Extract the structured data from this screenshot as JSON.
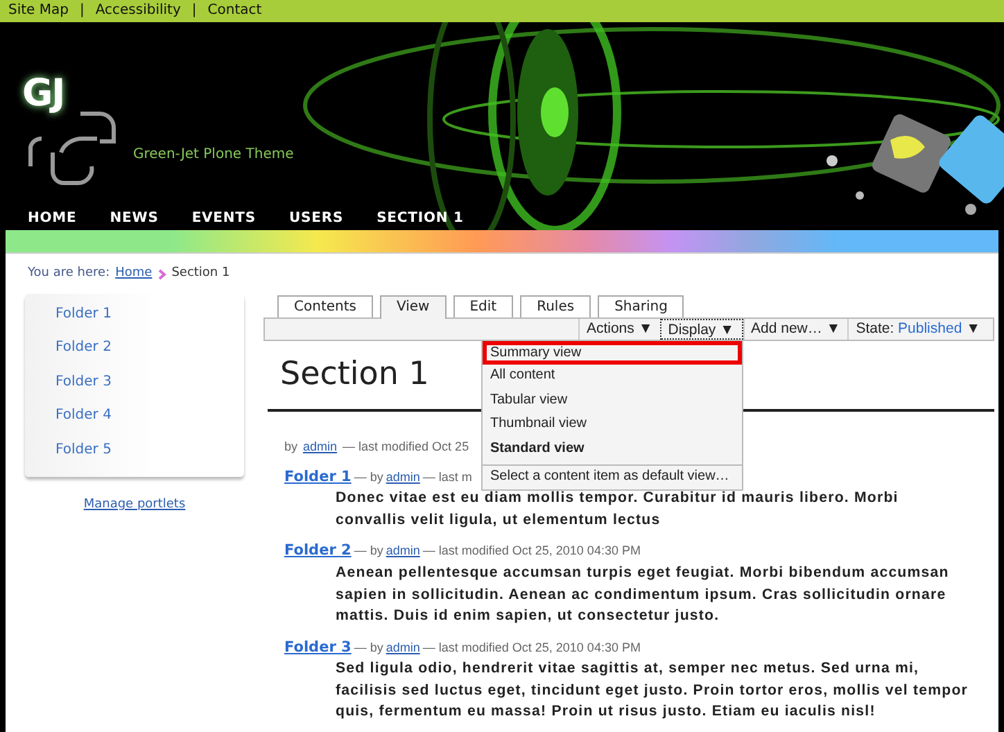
{
  "top_links": [
    {
      "label": "Site Map"
    },
    {
      "label": "Accessibility"
    },
    {
      "label": "Contact"
    }
  ],
  "top_separator": "|",
  "header": {
    "logo": "GJ",
    "tagline": "Green-Jet Plone Theme"
  },
  "nav": [
    {
      "label": "HOME"
    },
    {
      "label": "NEWS"
    },
    {
      "label": "EVENTS"
    },
    {
      "label": "USERS"
    },
    {
      "label": "SECTION 1"
    }
  ],
  "breadcrumb": {
    "prefix": "You are here:",
    "items": [
      {
        "label": "Home",
        "link": true
      },
      {
        "label": "Section 1",
        "link": false
      }
    ]
  },
  "sidebar": {
    "items": [
      {
        "label": "Folder 1"
      },
      {
        "label": "Folder 2"
      },
      {
        "label": "Folder 3"
      },
      {
        "label": "Folder 4"
      },
      {
        "label": "Folder 5"
      }
    ],
    "manage_link": "Manage portlets"
  },
  "tabs": [
    {
      "label": "Contents",
      "selected": false
    },
    {
      "label": "View",
      "selected": true
    },
    {
      "label": "Edit",
      "selected": false
    },
    {
      "label": "Rules",
      "selected": false
    },
    {
      "label": "Sharing",
      "selected": false
    }
  ],
  "toolbar": [
    {
      "label": "Actions",
      "caret": "▼",
      "open": false
    },
    {
      "label": "Display",
      "caret": "▼",
      "open": true
    },
    {
      "label": "Add new…",
      "caret": "▼",
      "open": false
    },
    {
      "label": "State:",
      "value": "Published",
      "caret": "▼",
      "open": false
    }
  ],
  "display_menu": [
    {
      "label": "Summary view",
      "highlighted": true,
      "current": false,
      "kind": "item"
    },
    {
      "label": "All content",
      "highlighted": false,
      "current": false,
      "kind": "item"
    },
    {
      "label": "Tabular view",
      "highlighted": false,
      "current": false,
      "kind": "item"
    },
    {
      "label": "Thumbnail view",
      "highlighted": false,
      "current": false,
      "kind": "item"
    },
    {
      "label": "Standard view",
      "highlighted": false,
      "current": true,
      "kind": "item"
    },
    {
      "label": "Select a content item as default view…",
      "highlighted": false,
      "current": false,
      "kind": "separated"
    }
  ],
  "title": "Section 1",
  "byline": {
    "prefix": "by",
    "author": "admin",
    "suffix": "— last modified Oct 25"
  },
  "entries": [
    {
      "title": "Folder 1",
      "prefix": "— by",
      "author": "admin",
      "suffix": "— last m",
      "description": "Donec vitae est eu diam mollis tempor. Curabitur id mauris libero. Morbi convallis velit ligula, ut elementum lectus"
    },
    {
      "title": "Folder 2",
      "prefix": "— by",
      "author": "admin",
      "suffix": "— last modified Oct 25, 2010 04:30 PM",
      "description": "Aenean pellentesque accumsan turpis eget feugiat. Morbi bibendum accumsan sapien in sollicitudin. Aenean ac condimentum ipsum. Cras sollicitudin ornare mattis. Duis id enim sapien, ut consectetur justo."
    },
    {
      "title": "Folder 3",
      "prefix": "— by",
      "author": "admin",
      "suffix": "— last modified Oct 25, 2010 04:30 PM",
      "description": "Sed ligula odio, hendrerit vitae sagittis at, semper nec metus. Sed urna mi, facilisis sed luctus eget, tincidunt eget justo. Proin tortor eros, mollis vel tempor quis, fermentum eu massa! Proin ut risus justo. Etiam eu iaculis nisl!"
    }
  ]
}
